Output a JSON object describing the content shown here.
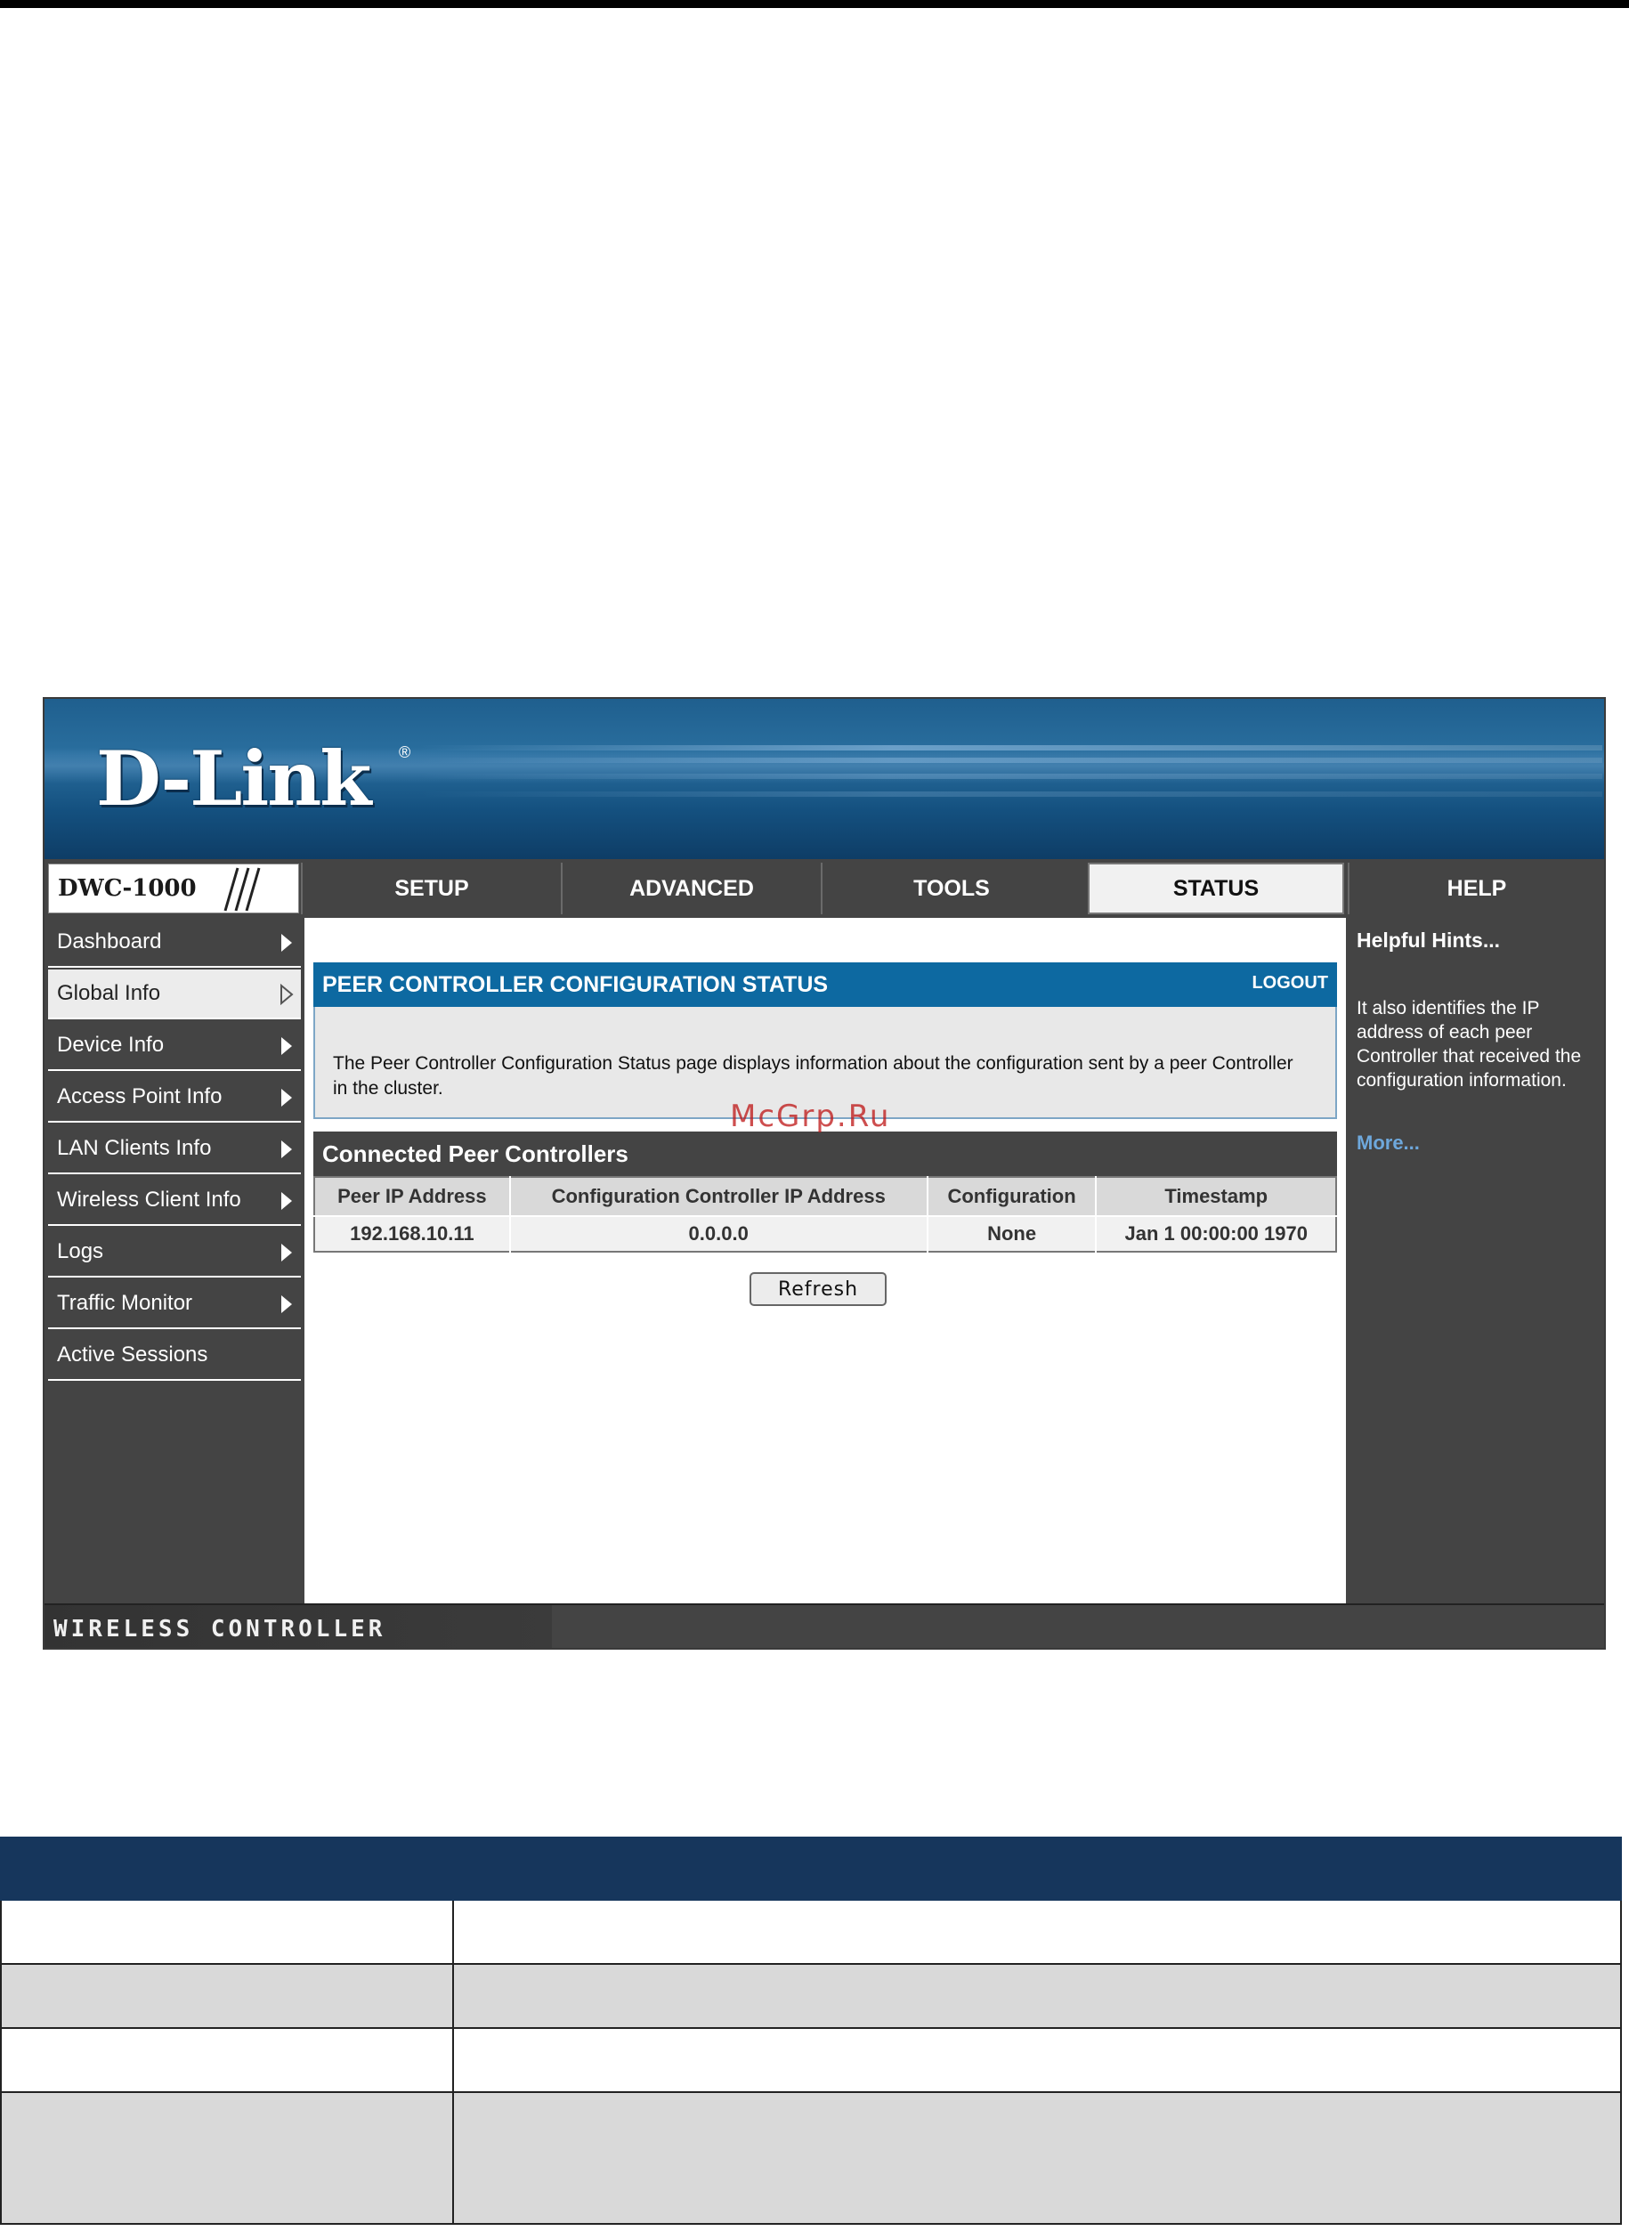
{
  "brand": {
    "logo": "D-Link",
    "reg": "®",
    "model": "DWC-1000"
  },
  "nav": {
    "tabs": [
      {
        "label": "SETUP"
      },
      {
        "label": "ADVANCED"
      },
      {
        "label": "TOOLS"
      },
      {
        "label": "STATUS",
        "active": true
      },
      {
        "label": "HELP"
      }
    ]
  },
  "sidebar": {
    "items": [
      {
        "label": "Dashboard"
      },
      {
        "label": "Global Info",
        "active": true
      },
      {
        "label": "Device Info"
      },
      {
        "label": "Access Point Info"
      },
      {
        "label": "LAN Clients Info"
      },
      {
        "label": "Wireless Client Info"
      },
      {
        "label": "Logs"
      },
      {
        "label": "Traffic Monitor"
      },
      {
        "label": "Active Sessions"
      }
    ]
  },
  "panel": {
    "title": "PEER CONTROLLER CONFIGURATION STATUS",
    "logout": "LOGOUT",
    "description": "The Peer Controller Configuration Status page displays information about the configuration sent by a peer Controller in the cluster."
  },
  "table": {
    "title": "Connected Peer Controllers",
    "headers": [
      "Peer IP Address",
      "Configuration Controller IP Address",
      "Configuration",
      "Timestamp"
    ],
    "rows": [
      [
        "192.168.10.11",
        "0.0.0.0",
        "None",
        "Jan 1 00:00:00 1970"
      ]
    ]
  },
  "refresh_label": "Refresh",
  "help": {
    "title": "Helpful Hints...",
    "text": "It also identifies the IP address of each peer Controller that received the configuration information.",
    "more": "More..."
  },
  "footer": "WIRELESS CONTROLLER",
  "watermark": "McGrp.Ru",
  "colors": {
    "header_blue": "#0d69a1",
    "doc_table_header": "#16365c",
    "ui_gray": "#444444"
  }
}
